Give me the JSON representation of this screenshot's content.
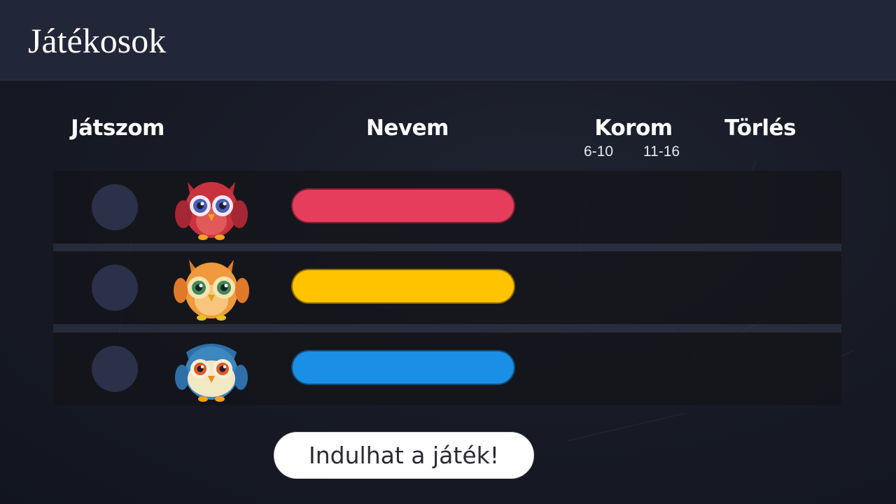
{
  "header": {
    "title": "Játékosok"
  },
  "columns": {
    "play": "Játszom",
    "name": "Nevem",
    "age": "Korom",
    "age_options": [
      "6-10",
      "11-16"
    ],
    "delete": "Törlés"
  },
  "players": [
    {
      "owl": "red-owl-icon",
      "bar_color": "#e63d5c",
      "name": ""
    },
    {
      "owl": "orange-owl-icon",
      "bar_color": "#ffc300",
      "name": ""
    },
    {
      "owl": "blue-owl-icon",
      "bar_color": "#1b8fe6",
      "name": ""
    }
  ],
  "actions": {
    "start_label": "Indulhat a játék!"
  },
  "colors": {
    "header_bg": "#222639",
    "radio": "#2a3148",
    "button_bg": "#ffffff"
  }
}
